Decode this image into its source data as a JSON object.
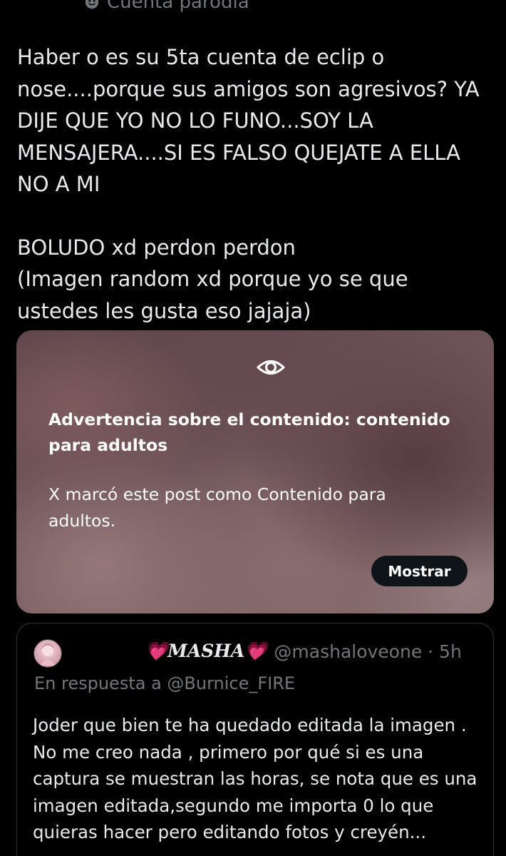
{
  "parody": {
    "label": "Cuenta parodia",
    "icon": "parody-mask-icon"
  },
  "post": {
    "paragraph1": "Haber o es su 5ta cuenta de eclip o nose....porque sus amigos son agresivos? YA DIJE QUE YO NO LO FUNO...SOY LA MENSAJERA....SI ES FALSO QUEJATE A ELLA NO A MI",
    "paragraph2": "BOLUDO xd perdon perdon\n(Imagen random xd porque yo se que ustedes les gusta eso jajaja)"
  },
  "media_warning": {
    "icon": "eye-icon",
    "title": "Advertencia sobre el contenido: contenido para adultos",
    "body": "X marcó este post como Contenido para adultos.",
    "button_label": "Mostrar"
  },
  "quoted_post": {
    "display_name": "💗𝑴𝑨𝑺𝑯𝑨💗",
    "handle_time": "@mashaloveone · 5h",
    "reply_to": "En respuesta a @Burnice_FIRE",
    "text": "Joder que bien te ha quedado editada la imagen .\nNo me creo nada , primero por qué si es una captura se muestran las horas, se nota que es una imagen editada,segundo me importa 0 lo que quieras hacer pero editando fotos y creyén..."
  },
  "colors": {
    "background": "#000000",
    "text_primary": "#e7e9ea",
    "text_secondary": "#71767b",
    "border": "#2f3336",
    "button_bg": "#0f1419"
  }
}
